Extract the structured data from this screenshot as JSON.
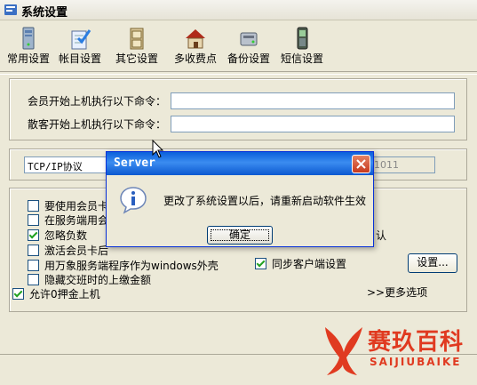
{
  "window": {
    "title": "系统设置"
  },
  "toolbar": {
    "items": [
      {
        "label": "常用设置",
        "icon": "server-tower-icon"
      },
      {
        "label": "帐目设置",
        "icon": "notepad-check-icon"
      },
      {
        "label": "其它设置",
        "icon": "cabinet-icon"
      },
      {
        "label": "多收费点",
        "icon": "house-icon"
      },
      {
        "label": "备份设置",
        "icon": "disk-drive-icon"
      },
      {
        "label": "短信设置",
        "icon": "mobile-phone-icon"
      }
    ]
  },
  "commands": {
    "member_label": "会员开始上机执行以下命令：",
    "member_value": "",
    "guest_label": "散客开始上机执行以下命令：",
    "guest_value": ""
  },
  "network": {
    "protocol": "TCP/IP协议",
    "port_partial": "1011"
  },
  "options": {
    "items": [
      {
        "label": "要使用会员卡",
        "checked": false
      },
      {
        "label": "在服务端用会",
        "checked": false
      },
      {
        "label": "忽略负数",
        "checked": true
      },
      {
        "label": "激活会员卡后",
        "checked": false
      },
      {
        "label": "用万象服务端程序作为windows外壳",
        "checked": false
      },
      {
        "label": "隐藏交班时的上缴金额",
        "checked": false
      },
      {
        "label": "允许0押金上机",
        "checked": true
      }
    ],
    "right_partial_label": "认",
    "sync_client": {
      "label": "同步客户端设置",
      "checked": true
    },
    "settings_button": "设置...",
    "more_options": ">>更多选项"
  },
  "dialog": {
    "title": "Server",
    "message": "更改了系统设置以后，请重新启动软件生效",
    "ok_button": "确定"
  },
  "watermark": {
    "text_cn": "赛玖百科",
    "text_en": "SAIJIUBAIKE"
  },
  "colors": {
    "window_bg": "#ece9d8",
    "dialog_title": "#0a5fdb",
    "close_button": "#c7391c",
    "watermark": "#e03a20",
    "check_mark": "#21a121"
  }
}
